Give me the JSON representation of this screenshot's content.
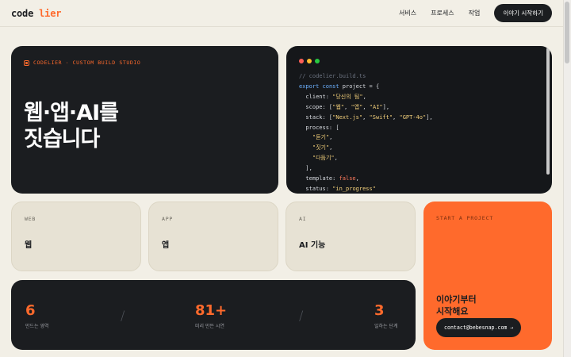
{
  "header": {
    "logo_part1": "code",
    "logo_part2": "lier",
    "nav": [
      "서비스",
      "프로세스",
      "작업"
    ],
    "cta": "이야기 시작하기"
  },
  "hero": {
    "eyebrow": "CODELIER · CUSTOM BUILD STUDIO",
    "title_line1": "웹·앱·AI를",
    "title_line2": "짓습니다"
  },
  "code_window": {
    "dot_colors": [
      "#ff5f57",
      "#febc2e",
      "#28c840"
    ],
    "comment": "// codelier.build.ts",
    "kw_export": "export",
    "kw_const": "const",
    "var_decl": " project = {",
    "client_key": "  client: ",
    "client_val": "\"당신의 팀\"",
    "scope_key": "  scope: [",
    "scope_vals": [
      "\"웹\"",
      "\"앱\"",
      "\"AI\""
    ],
    "scope_close": "],",
    "stack_key": "  stack: [",
    "stack_vals": [
      "\"Next.js\"",
      "\"Swift\"",
      "\"GPT-4o\""
    ],
    "stack_close": "],",
    "process_key": "  process: [",
    "process_vals": [
      "\"듣기\"",
      "\"짓기\"",
      "\"다듬기\""
    ],
    "process_close": "  ],",
    "template_key": "  template: ",
    "template_val": "false",
    "status_key": "  status: ",
    "status_val": "\"in_progress\""
  },
  "services": [
    {
      "label": "WEB",
      "name": "웹"
    },
    {
      "label": "APP",
      "name": "앱"
    },
    {
      "label": "AI",
      "name": "AI 기능"
    }
  ],
  "start": {
    "label": "START A PROJECT",
    "title_line1": "이야기부터",
    "title_line2": "시작해요",
    "contact": "contact@bebesnap.com →"
  },
  "stats": [
    {
      "value": "6",
      "label": "만드는 영역"
    },
    {
      "value": "81+",
      "label": "미리 만든 시연"
    },
    {
      "value": "3",
      "label": "일하는 단계"
    }
  ],
  "divider_glyph": "/",
  "colors": {
    "accent": "#ff6a2c",
    "dark": "#1b1d20",
    "background": "#f2efe6",
    "card_light": "#e7e2d4"
  }
}
